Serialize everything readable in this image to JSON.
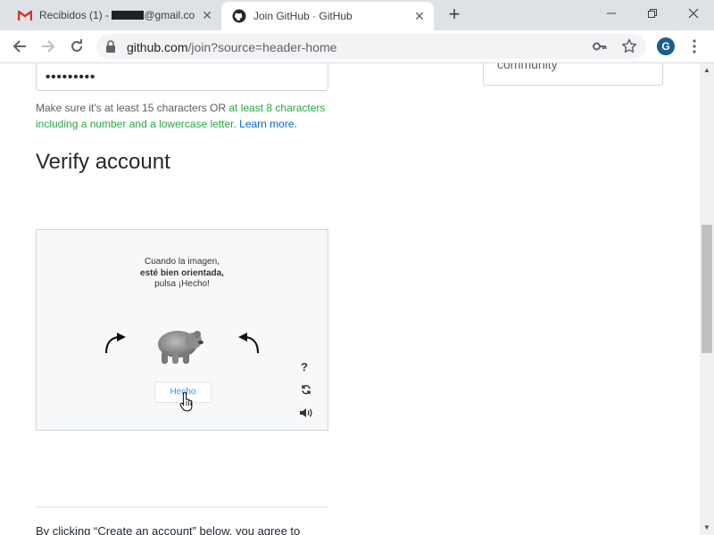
{
  "browser": {
    "tabs": [
      {
        "title_prefix": "Recibidos (1) - ",
        "title_suffix": "@gmail.co",
        "close": "✕"
      },
      {
        "title": "Join GitHub · GitHub",
        "close": "✕"
      }
    ],
    "new_tab": "+",
    "window_controls": {
      "minimize": "—",
      "maximize": "❐",
      "close": "✕"
    },
    "url_host": "github.com",
    "url_path": "/join?source=header-home",
    "profile_initial": "G"
  },
  "page": {
    "password_value": "•••••••••",
    "password_hint": {
      "text1": "Make sure it's at least 15 characters OR ",
      "ok_text": "at least 8 characters including a number and a lowercase letter",
      "text2": ". ",
      "link": "Learn more",
      "end": "."
    },
    "verify_heading": "Verify account",
    "sidebox_text": "community",
    "terms_text": "By clicking “Create an account” below, you agree to"
  },
  "captcha": {
    "instruction_line1": "Cuando la imagen,",
    "instruction_line2": "esté bien orientada,",
    "instruction_line3": "pulsa ¡Hecho!",
    "done_button": "Hecho",
    "help": "?"
  },
  "scrollbar": {
    "up": "▲",
    "down": "▼"
  }
}
